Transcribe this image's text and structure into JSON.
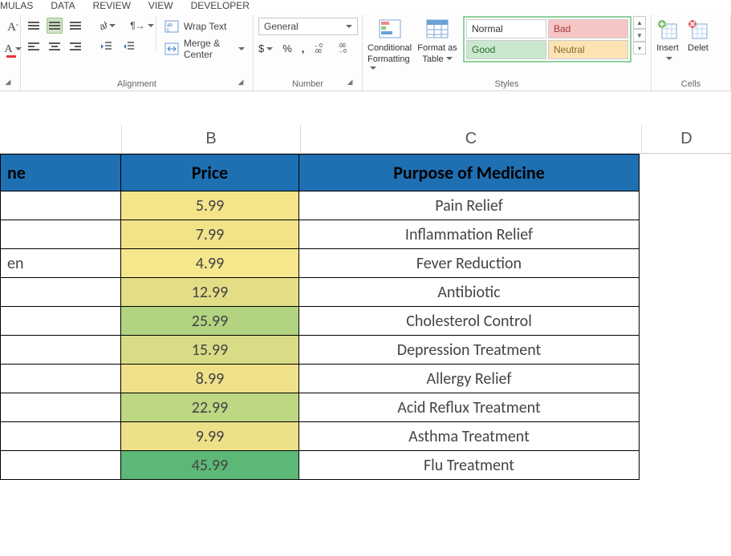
{
  "tabs": {
    "formulas": "MULAS",
    "data": "DATA",
    "review": "REVIEW",
    "view": "VIEW",
    "developer": "DEVELOPER"
  },
  "ribbon": {
    "alignment": {
      "wrap_label": "Wrap Text",
      "merge_label": "Merge & Center",
      "group_label": "Alignment"
    },
    "number": {
      "format_value": "General",
      "group_label": "Number",
      "currency": "$",
      "percent": "%",
      "comma": ",",
      "inc_dec": "←0 .00",
      "dec_dec": ".00 →0"
    },
    "styles": {
      "cond_fmt_label1": "Conditional",
      "cond_fmt_label2": "Formatting",
      "fmt_table_label1": "Format as",
      "fmt_table_label2": "Table",
      "normal": "Normal",
      "bad": "Bad",
      "good": "Good",
      "neutral": "Neutral",
      "group_label": "Styles"
    },
    "cells": {
      "insert_label": "Insert",
      "delete_label": "Delet",
      "group_label": "Cells"
    }
  },
  "columns": {
    "B": "B",
    "C": "C",
    "D": "D"
  },
  "headers": {
    "A": "ne",
    "B": "Price",
    "C": "Purpose of Medicine"
  },
  "rows": [
    {
      "a": "",
      "price": "5.99",
      "purpose": "Pain Relief",
      "bcolor": "#f4e48a"
    },
    {
      "a": "",
      "price": "7.99",
      "purpose": "Inflammation Relief",
      "bcolor": "#f2e389"
    },
    {
      "a": "en",
      "price": "4.99",
      "purpose": "Fever Reduction",
      "bcolor": "#f6e68c"
    },
    {
      "a": "",
      "price": "12.99",
      "purpose": "Antibiotic",
      "bcolor": "#e3de86"
    },
    {
      "a": "",
      "price": "25.99",
      "purpose": "Cholesterol Control",
      "bcolor": "#b2d481"
    },
    {
      "a": "",
      "price": "15.99",
      "purpose": "Depression Treatment",
      "bcolor": "#d9dc85"
    },
    {
      "a": "",
      "price": "8.99",
      "purpose": "Allergy Relief",
      "bcolor": "#efe189"
    },
    {
      "a": "",
      "price": "22.99",
      "purpose": "Acid Reflux Treatment",
      "bcolor": "#bdd783"
    },
    {
      "a": "",
      "price": "9.99",
      "purpose": "Asthma Treatment",
      "bcolor": "#ece088"
    },
    {
      "a": "",
      "price": "45.99",
      "purpose": "Flu Treatment",
      "bcolor": "#5cb877"
    }
  ]
}
